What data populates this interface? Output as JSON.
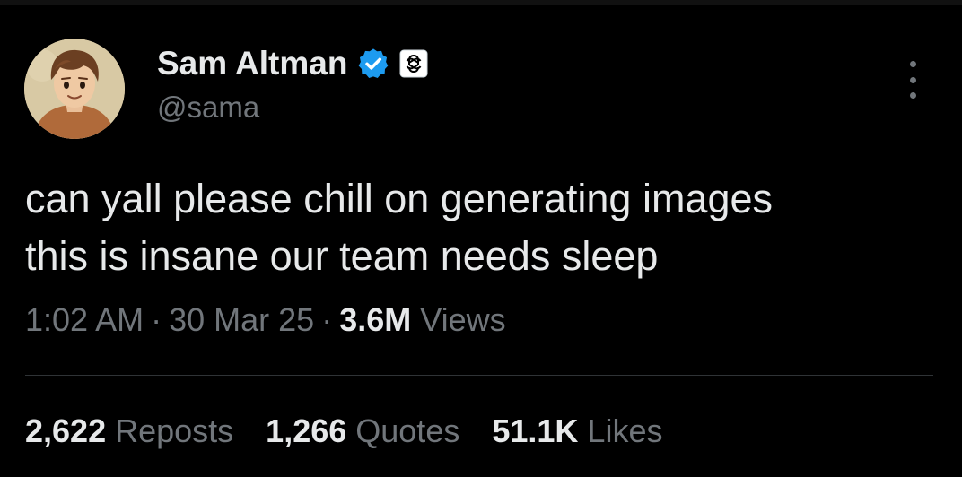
{
  "author": {
    "display_name": "Sam Altman",
    "handle": "@sama",
    "verified_icon": "verified-badge-icon",
    "affiliate_icon": "openai-logo-icon"
  },
  "tweet": {
    "lines": [
      "can yall please chill on generating images",
      "this is insane our team needs sleep"
    ]
  },
  "meta": {
    "time": "1:02 AM",
    "separator": "·",
    "date": "30 Mar 25",
    "views_count": "3.6M",
    "views_label": "Views"
  },
  "stats": {
    "reposts_count": "2,622",
    "reposts_label": "Reposts",
    "quotes_count": "1,266",
    "quotes_label": "Quotes",
    "likes_count": "51.1K",
    "likes_label": "Likes"
  },
  "colors": {
    "background": "#000000",
    "primary_text": "#e7e9ea",
    "secondary_text": "#71767b",
    "verified_blue": "#1d9bf0",
    "divider": "#2f3336"
  }
}
